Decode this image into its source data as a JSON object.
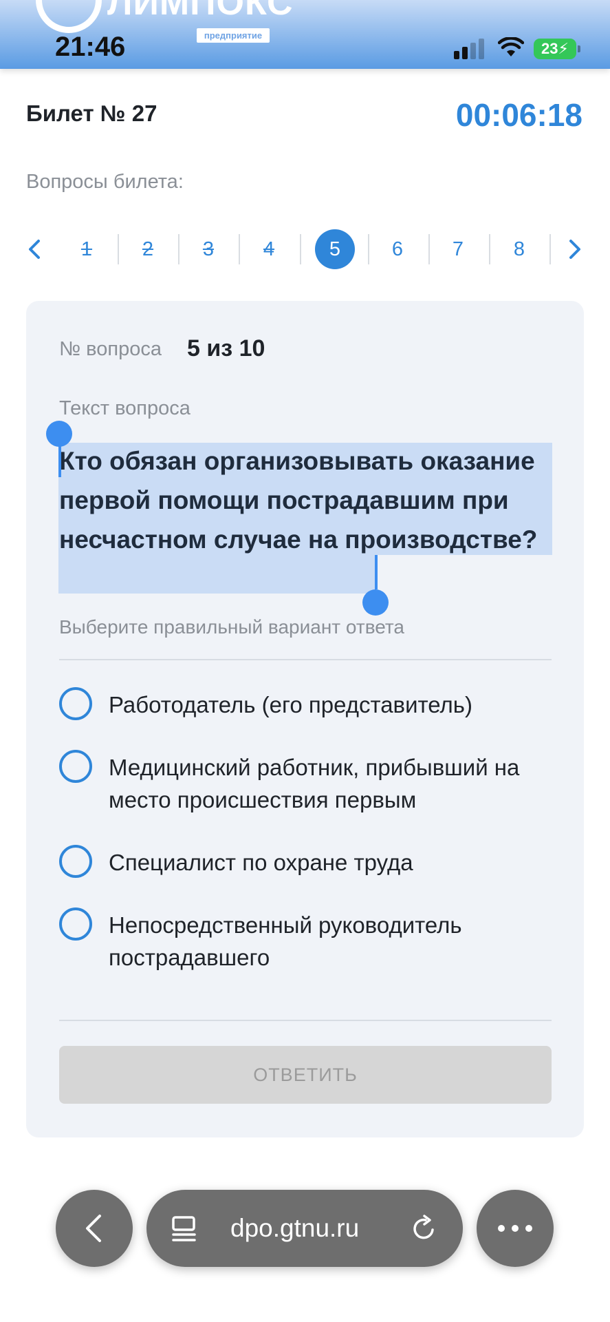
{
  "status_bar": {
    "time": "21:46",
    "battery": "23",
    "banner_logo": "ЛИМПОКС",
    "banner_sub": "предприятие"
  },
  "header": {
    "ticket": "Билет № 27",
    "timer": "00:06:18",
    "questions_label": "Вопросы билета:"
  },
  "pagination": {
    "items": [
      {
        "label": "1",
        "state": "done"
      },
      {
        "label": "2",
        "state": "done"
      },
      {
        "label": "3",
        "state": "done"
      },
      {
        "label": "4",
        "state": "done"
      },
      {
        "label": "5",
        "state": "current"
      },
      {
        "label": "6",
        "state": "pending"
      },
      {
        "label": "7",
        "state": "pending"
      },
      {
        "label": "8",
        "state": "pending"
      }
    ]
  },
  "question": {
    "number_label": "№ вопроса",
    "number_value": "5 из 10",
    "text_label": "Текст вопроса",
    "text": "Кто обязан организовывать оказание первой помощи пострадавшим при несчастном случае на производстве?",
    "hint": "Выберите правильный вариант ответа",
    "options": [
      "Работодатель (его представитель)",
      "Медицинский работник, прибывший на место происшествия первым",
      "Специалист по охране труда",
      "Непосредственный руководитель пострадавшего"
    ],
    "answer_button": "ОТВЕТИТЬ"
  },
  "browser": {
    "url": "dpo.gtnu.ru"
  },
  "colors": {
    "accent": "#2f86d9",
    "card_bg": "#f0f3f8",
    "disabled_button": "#d6d6d6"
  }
}
